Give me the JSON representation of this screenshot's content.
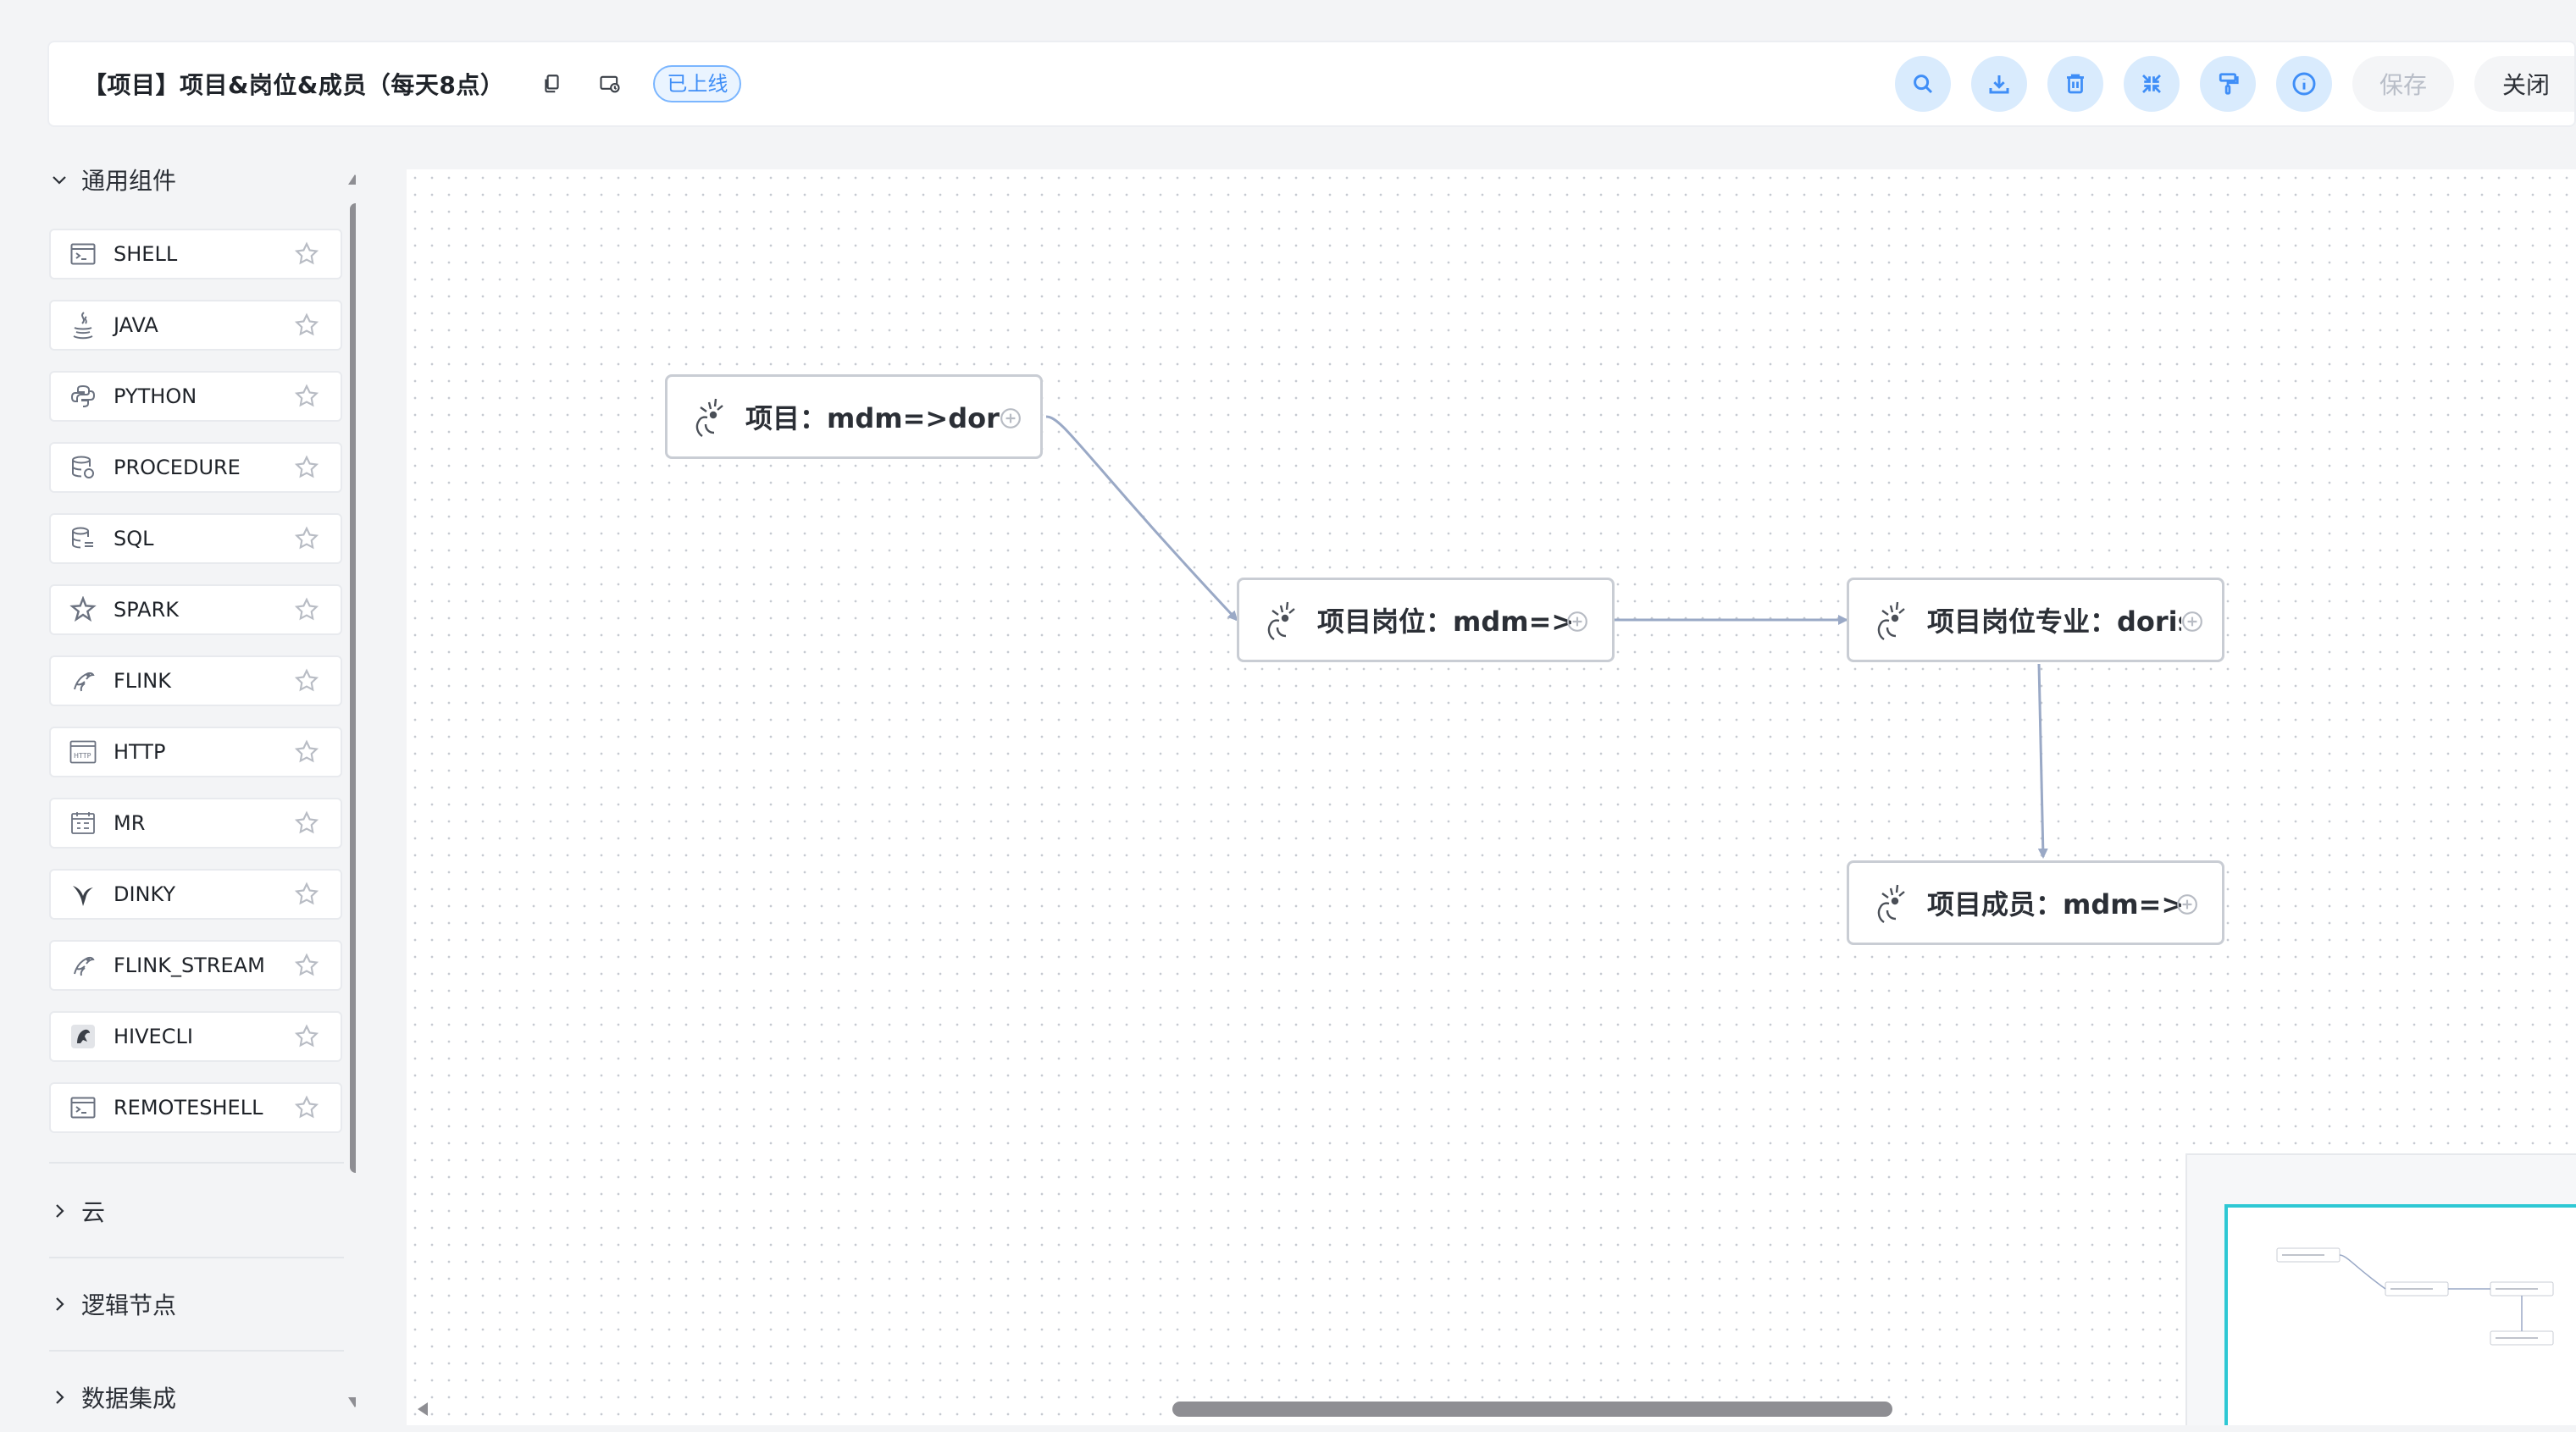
{
  "header": {
    "title": "【项目】项目&岗位&成员（每天8点）",
    "copy_icon": "copy-icon",
    "version_icon": "version-icon",
    "status": "已上线",
    "toolbar": {
      "search_icon": "search-icon",
      "download_icon": "download-icon",
      "delete_icon": "delete-icon",
      "fullscreen_icon": "fullscreen-icon",
      "format_icon": "format-painter-icon",
      "info_icon": "info-icon",
      "save_label": "保存",
      "close_label": "关闭"
    }
  },
  "sidebar": {
    "sections": [
      {
        "label": "通用组件",
        "expanded": true
      },
      {
        "label": "云",
        "expanded": false
      },
      {
        "label": "逻辑节点",
        "expanded": false
      },
      {
        "label": "数据集成",
        "expanded": false
      }
    ],
    "components": [
      {
        "label": "SHELL",
        "icon": "shell-icon"
      },
      {
        "label": "JAVA",
        "icon": "java-icon"
      },
      {
        "label": "PYTHON",
        "icon": "python-icon"
      },
      {
        "label": "PROCEDURE",
        "icon": "procedure-icon"
      },
      {
        "label": "SQL",
        "icon": "sql-icon"
      },
      {
        "label": "SPARK",
        "icon": "spark-icon"
      },
      {
        "label": "FLINK",
        "icon": "flink-icon"
      },
      {
        "label": "HTTP",
        "icon": "http-icon"
      },
      {
        "label": "MR",
        "icon": "mr-icon"
      },
      {
        "label": "DINKY",
        "icon": "dinky-icon"
      },
      {
        "label": "FLINK_STREAM",
        "icon": "flink-stream-icon"
      },
      {
        "label": "HIVECLI",
        "icon": "hivecli-icon"
      },
      {
        "label": "REMOTESHELL",
        "icon": "remoteshell-icon"
      }
    ]
  },
  "canvas": {
    "nodes": [
      {
        "label": "项目：mdm=>doris",
        "icon": "task-node-icon"
      },
      {
        "label": "项目岗位：mdm=>d…i…",
        "icon": "task-node-icon"
      },
      {
        "label": "项目岗位专业：doris…",
        "icon": "task-node-icon"
      },
      {
        "label": "项目成员：mdm=>d…i…",
        "icon": "task-node-icon"
      }
    ],
    "colors": {
      "edge": "#9aa9c6",
      "node_border": "#c9cdd4",
      "minimap_viewport": "#2ec8d4",
      "toolbar_button": "#d9ebfd",
      "toolbar_icon": "#3f8ef7"
    }
  }
}
